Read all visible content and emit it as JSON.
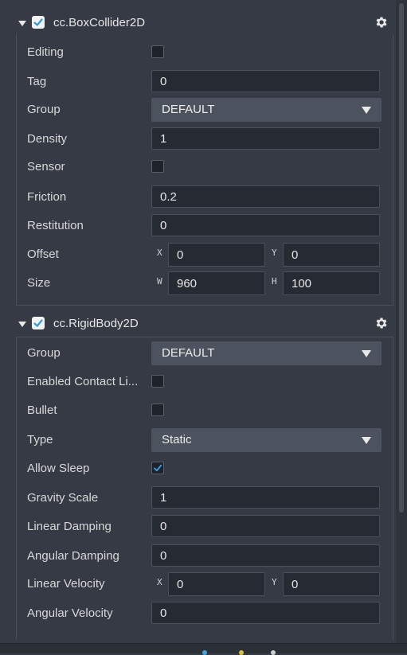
{
  "box_collider": {
    "title": "cc.BoxCollider2D",
    "enabled": true,
    "editing": {
      "label": "Editing",
      "checked": false
    },
    "tag": {
      "label": "Tag",
      "value": "0"
    },
    "group": {
      "label": "Group",
      "value": "DEFAULT"
    },
    "density": {
      "label": "Density",
      "value": "1"
    },
    "sensor": {
      "label": "Sensor",
      "checked": false
    },
    "friction": {
      "label": "Friction",
      "value": "0.2"
    },
    "restitution": {
      "label": "Restitution",
      "value": "0"
    },
    "offset": {
      "label": "Offset",
      "x_axis": "X",
      "y_axis": "Y",
      "x": "0",
      "y": "0"
    },
    "size": {
      "label": "Size",
      "w_axis": "W",
      "h_axis": "H",
      "w": "960",
      "h": "100"
    }
  },
  "rigid_body": {
    "title": "cc.RigidBody2D",
    "enabled": true,
    "group": {
      "label": "Group",
      "value": "DEFAULT"
    },
    "enabled_contact_listener": {
      "label": "Enabled Contact Li...",
      "checked": false
    },
    "bullet": {
      "label": "Bullet",
      "checked": false
    },
    "type": {
      "label": "Type",
      "value": "Static"
    },
    "allow_sleep": {
      "label": "Allow Sleep",
      "checked": true
    },
    "gravity_scale": {
      "label": "Gravity Scale",
      "value": "1"
    },
    "linear_damping": {
      "label": "Linear Damping",
      "value": "0"
    },
    "angular_damping": {
      "label": "Angular Damping",
      "value": "0"
    },
    "linear_velocity": {
      "label": "Linear Velocity",
      "x_axis": "X",
      "y_axis": "Y",
      "x": "0",
      "y": "0"
    },
    "angular_velocity": {
      "label": "Angular Velocity",
      "value": "0"
    }
  },
  "icons": {
    "expand": "chevron-down-icon",
    "settings": "gear-icon",
    "dropdown": "caret-down-icon",
    "check": "checkmark-icon"
  },
  "colors": {
    "accent_check": "#2f9ee0",
    "panel_bg": "#353a44",
    "input_bg": "#262a32",
    "select_bg": "#4d535e"
  }
}
